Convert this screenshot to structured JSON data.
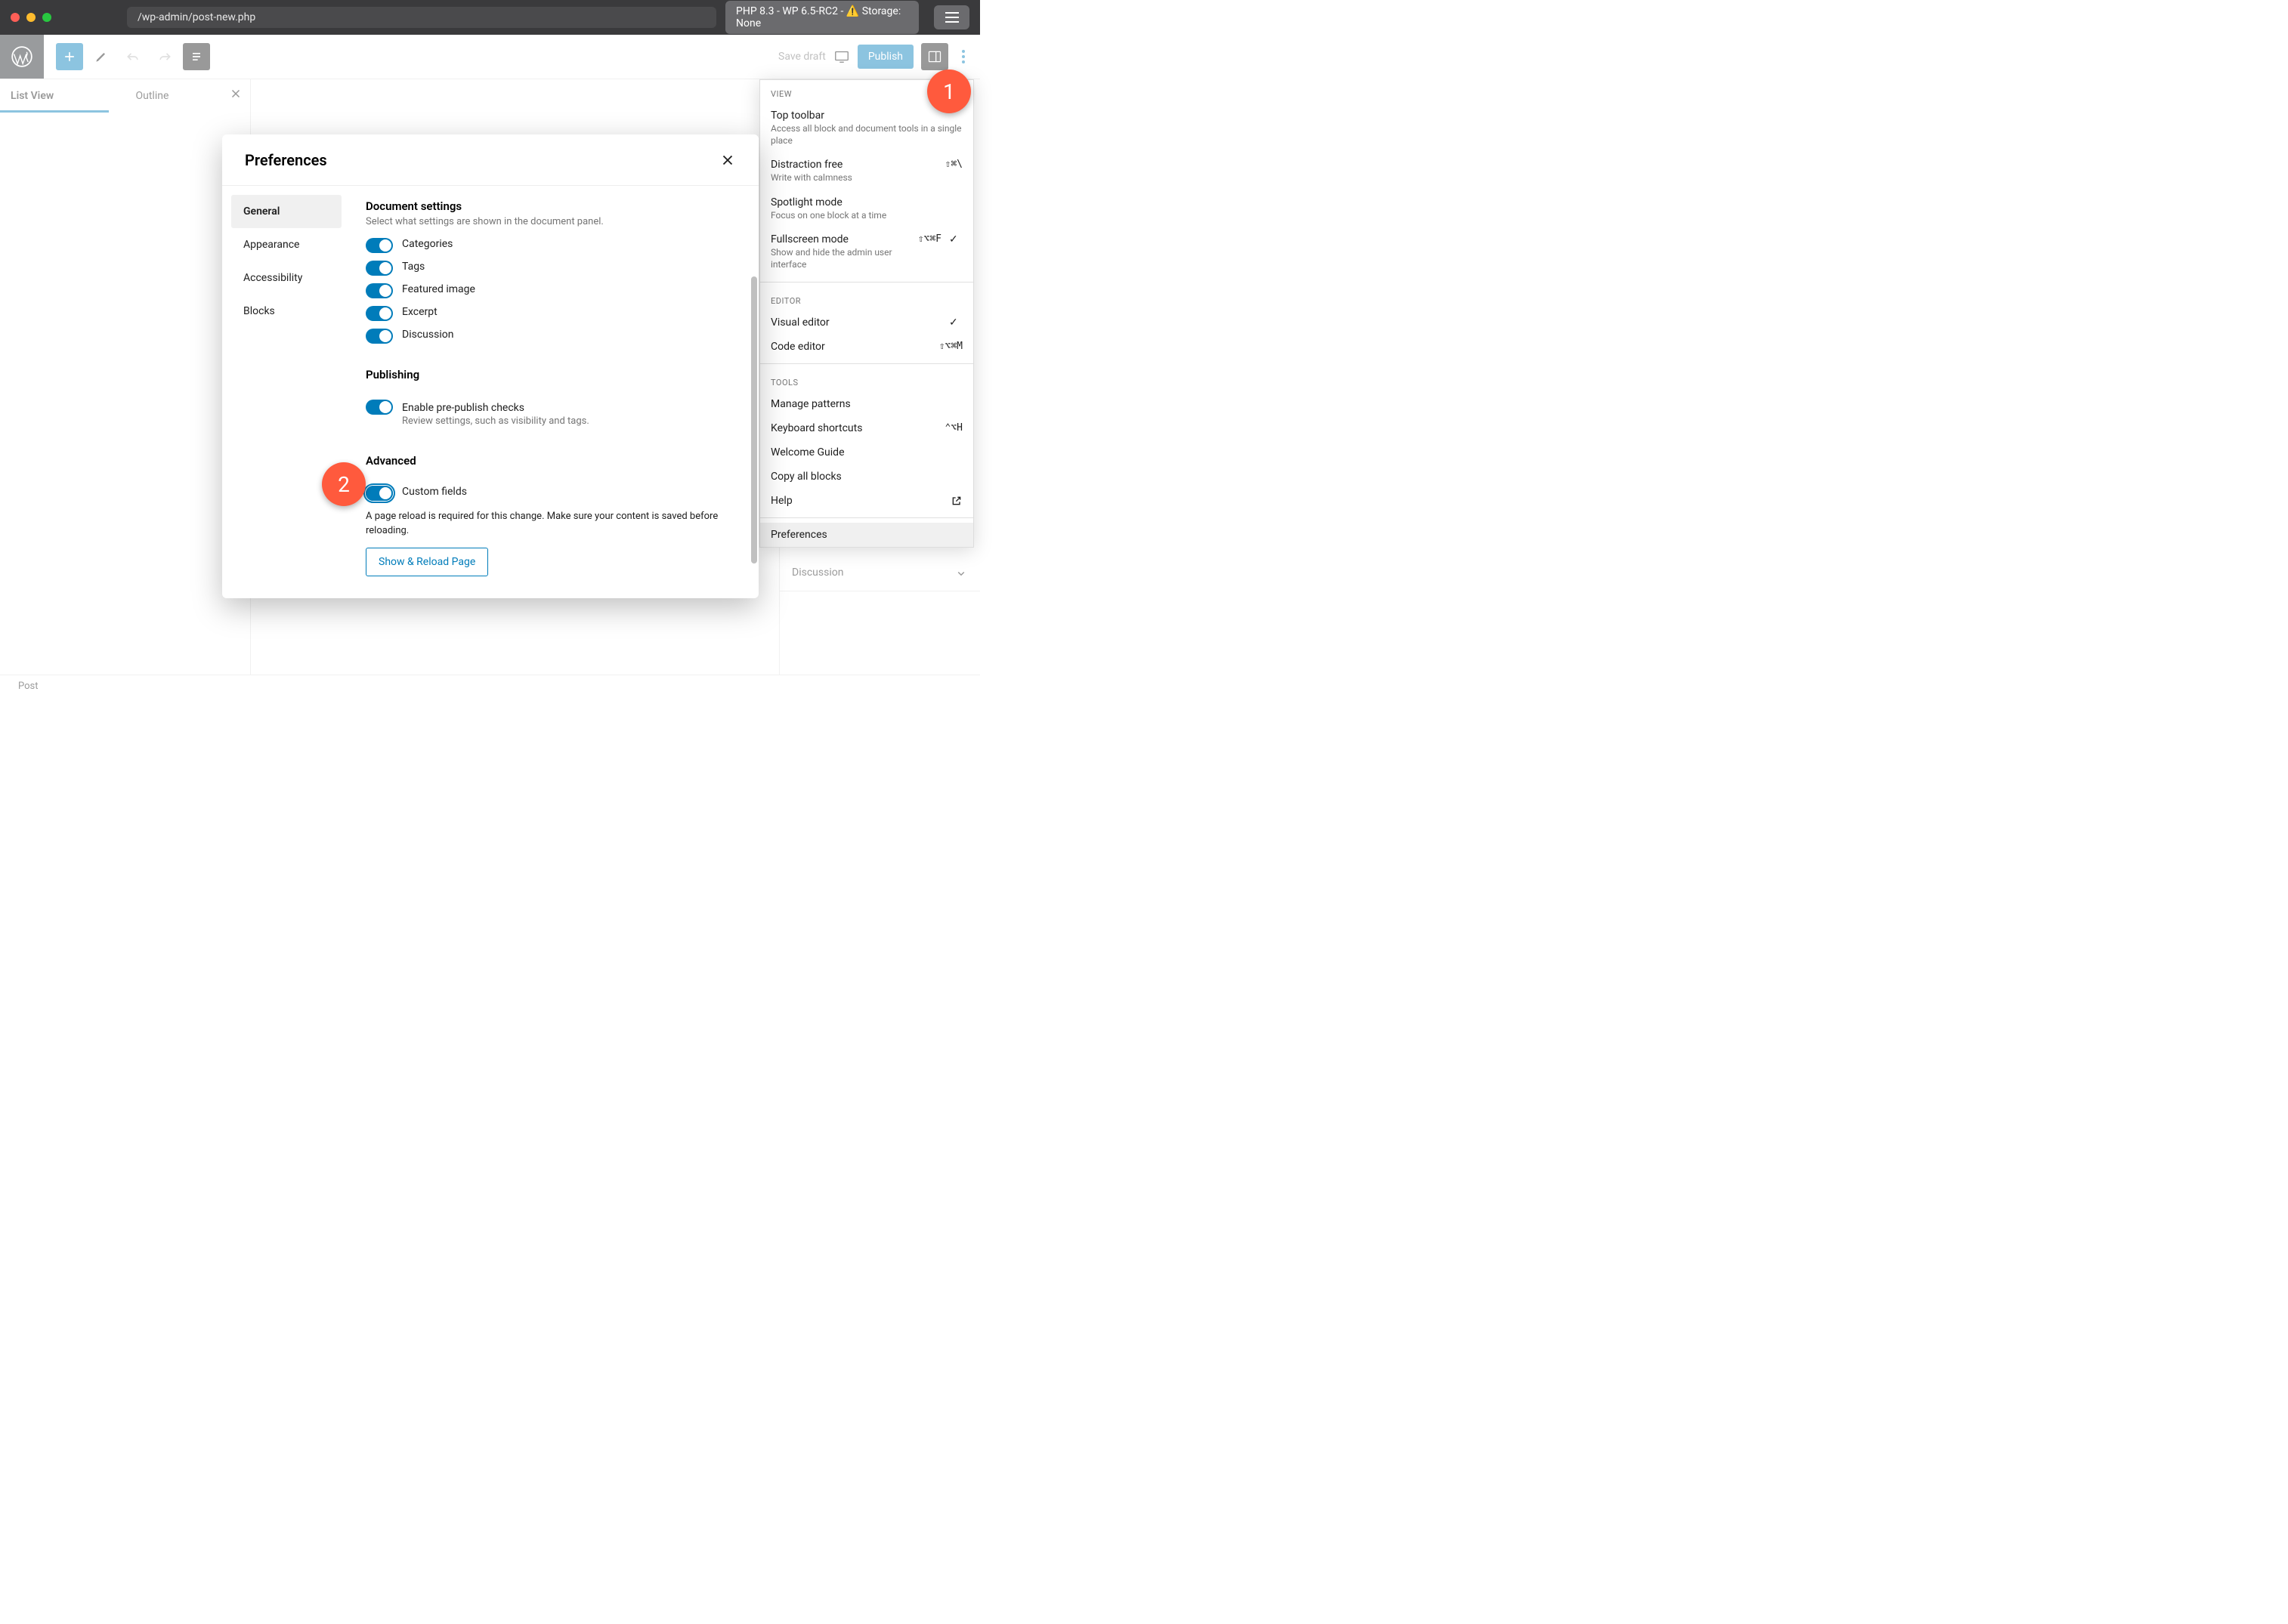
{
  "window": {
    "url": "/wp-admin/post-new.php",
    "status_pill": "PHP 8.3 - WP 6.5-RC2 - ⚠️ Storage: None"
  },
  "toolbar": {
    "save_draft": "Save draft",
    "publish": "Publish"
  },
  "left_panel": {
    "tab_list": "List View",
    "tab_outline": "Outline"
  },
  "more_menu": {
    "section_view": "View",
    "top_toolbar": {
      "label": "Top toolbar",
      "desc": "Access all block and document tools in a single place"
    },
    "distraction_free": {
      "label": "Distraction free",
      "desc": "Write with calmness",
      "shortcut": "⇧⌘\\"
    },
    "spotlight": {
      "label": "Spotlight mode",
      "desc": "Focus on one block at a time"
    },
    "fullscreen": {
      "label": "Fullscreen mode",
      "desc": "Show and hide the admin user interface",
      "shortcut": "⇧⌥⌘F",
      "checked": true
    },
    "section_editor": "Editor",
    "visual_editor": {
      "label": "Visual editor",
      "checked": true
    },
    "code_editor": {
      "label": "Code editor",
      "shortcut": "⇧⌥⌘M"
    },
    "section_tools": "Tools",
    "manage_patterns": "Manage patterns",
    "keyboard_shortcuts": {
      "label": "Keyboard shortcuts",
      "shortcut": "⌃⌥H"
    },
    "welcome_guide": "Welcome Guide",
    "copy_all_blocks": "Copy all blocks",
    "help": "Help",
    "preferences": "Preferences"
  },
  "right_sidebar": {
    "discussion": "Discussion"
  },
  "preferences_modal": {
    "title": "Preferences",
    "nav": {
      "general": "General",
      "appearance": "Appearance",
      "accessibility": "Accessibility",
      "blocks": "Blocks"
    },
    "doc_settings": {
      "heading": "Document settings",
      "desc": "Select what settings are shown in the document panel.",
      "categories": "Categories",
      "tags": "Tags",
      "featured_image": "Featured image",
      "excerpt": "Excerpt",
      "discussion": "Discussion"
    },
    "publishing": {
      "heading": "Publishing",
      "prepublish": "Enable pre-publish checks",
      "prepublish_desc": "Review settings, such as visibility and tags."
    },
    "advanced": {
      "heading": "Advanced",
      "custom_fields": "Custom fields",
      "reload_msg": "A page reload is required for this change. Make sure your content is saved before reloading.",
      "reload_btn": "Show & Reload Page"
    }
  },
  "footer": {
    "breadcrumb": "Post"
  },
  "annotations": {
    "a1": "1",
    "a2": "2"
  }
}
